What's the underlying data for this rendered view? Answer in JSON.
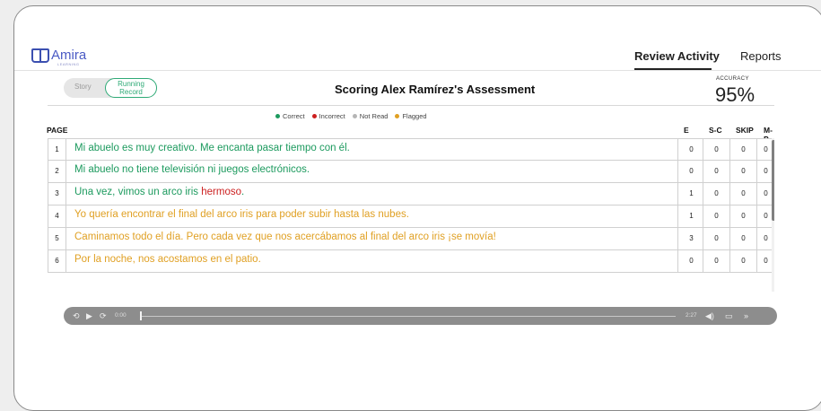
{
  "brand": {
    "name": "Amira",
    "sub": "LEARNING"
  },
  "nav": {
    "review": "Review Activity",
    "reports": "Reports"
  },
  "toggle": {
    "story": "Story",
    "running_record": "Running Record"
  },
  "title": "Scoring Alex Ramírez's Assessment",
  "accuracy": {
    "label": "ACCURACY",
    "value": "95%"
  },
  "legend": [
    {
      "label": "Correct",
      "color": "#1c9a5e"
    },
    {
      "label": "Incorrect",
      "color": "#cc1f1f"
    },
    {
      "label": "Not Read",
      "color": "#b5b5b5"
    },
    {
      "label": "Flagged",
      "color": "#e0a023"
    }
  ],
  "columns": {
    "page": "PAGE",
    "e": "E",
    "sc": "S-C",
    "skip": "SKIP",
    "mp": "M-P"
  },
  "rows": [
    {
      "num": "1",
      "segments": [
        {
          "t": "Mi abuelo es muy creativo. Me encanta pasar tiempo con él.",
          "s": "green"
        }
      ],
      "e": "0",
      "sc": "0",
      "skip": "0",
      "mp": "0"
    },
    {
      "num": "2",
      "segments": [
        {
          "t": "Mi abuelo no tiene televisión ni juegos electrónicos.",
          "s": "green"
        }
      ],
      "e": "0",
      "sc": "0",
      "skip": "0",
      "mp": "0"
    },
    {
      "num": "3",
      "segments": [
        {
          "t": "Una vez, vimos un arco iris ",
          "s": "green"
        },
        {
          "t": "hermoso",
          "s": "red"
        },
        {
          "t": ".",
          "s": "green"
        }
      ],
      "e": "1",
      "sc": "0",
      "skip": "0",
      "mp": "0"
    },
    {
      "num": "4",
      "segments": [
        {
          "t": "Yo quería encontrar el final del arco iris para poder subir hasta las nubes.",
          "s": "orange"
        }
      ],
      "e": "1",
      "sc": "0",
      "skip": "0",
      "mp": "0"
    },
    {
      "num": "5",
      "segments": [
        {
          "t": "Caminamos todo el día. Pero cada vez que nos acercábamos al final del arco iris ¡se movía!",
          "s": "orange"
        }
      ],
      "e": "3",
      "sc": "0",
      "skip": "0",
      "mp": "0"
    },
    {
      "num": "6",
      "segments": [
        {
          "t": "Por la noche, nos acostamos en el patio.",
          "s": "orange"
        }
      ],
      "e": "0",
      "sc": "0",
      "skip": "0",
      "mp": "0"
    }
  ],
  "player": {
    "current": "0:00",
    "duration": "2:27"
  }
}
